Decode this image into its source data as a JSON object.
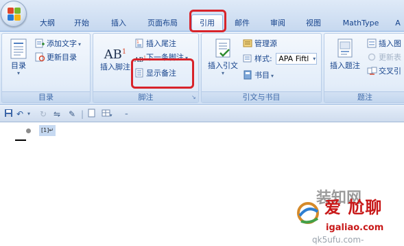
{
  "tabs": [
    "大纲",
    "开始",
    "插入",
    "页面布局",
    "引用",
    "邮件",
    "审阅",
    "视图",
    "MathType",
    "A"
  ],
  "active_tab": "引用",
  "groups": {
    "toc": {
      "label": "目录",
      "big": "目录",
      "add_text": "添加文字",
      "update": "更新目录"
    },
    "footnotes": {
      "label": "脚注",
      "insert_footnote": "插入脚注",
      "ab_icon": "AB",
      "ab_sup": "1",
      "insert_endnote": "插入尾注",
      "next_footnote": "下一条脚注",
      "show_notes": "显示备注"
    },
    "citations": {
      "label": "引文与书目",
      "insert_citation": "插入引文",
      "manage_sources": "管理源",
      "style_label": "样式:",
      "style_value": "APA Fiftl",
      "bibliography": "书目"
    },
    "captions": {
      "label": "题注",
      "insert_caption": "插入题注",
      "insert_table_of_figures": "插入图",
      "update_table": "更新表",
      "cross_reference": "交叉引"
    }
  },
  "document": {
    "note_reference": "[1]↵"
  },
  "watermark": {
    "ghost": "装知网",
    "line1": "爱 尬聊",
    "line2": "igaliao.com",
    "line3": "qk5ufu.com-"
  },
  "colors": {
    "highlight": "#d8232a",
    "tab_text": "#15428b",
    "ribbon_bg": "#dbe8f7",
    "note_highlight": "#c6d9f1"
  }
}
